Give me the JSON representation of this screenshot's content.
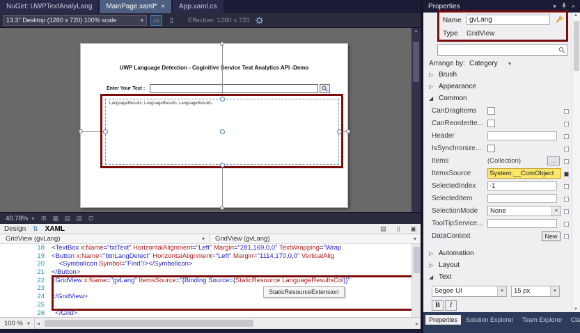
{
  "icons": {
    "dropdown": "▾",
    "close": "×",
    "monitor": "▭",
    "monitor2": "▯",
    "swap": "⇅",
    "grid1": "⊞",
    "grid2": "▦",
    "grid3": "▤",
    "grid4": "▥",
    "grid5": "⊡",
    "split1": "▤",
    "split2": "▯",
    "split3": "▣",
    "collapsed": "▷",
    "expanded": "◢",
    "scroll_up": "▲",
    "scroll_down": "▼",
    "scroll_left": "◂",
    "scroll_right": "▸"
  },
  "colors": {
    "annotation_red": "#7B0C0C",
    "active_tab_blue": "#4D6082",
    "highlight_yellow": "#FBE76B",
    "chrome_dark": "#1B1B35"
  },
  "window": {
    "doc_tabs": [
      {
        "label": "NuGet: UWPTextAnalyLang",
        "active": false,
        "closable": false
      },
      {
        "label": "MainPage.xaml*",
        "active": true,
        "closable": true
      },
      {
        "label": "App.xaml.cs",
        "active": false,
        "closable": false
      }
    ]
  },
  "designer": {
    "device_selector": "13.3\" Desktop (1280 x 720) 100% scale",
    "effective_label": "Effective: 1280 x 720",
    "zoom_value": "40.78%",
    "view_tabs": {
      "design": "Design",
      "xaml": "XAML"
    },
    "artboard": {
      "title": "UWP Language Detection - Coginitive Service Text Analytics API -Demo",
      "input_label": "Enter Your Text :",
      "gridview_text": "LanguageResults: LanguageResults: LanguageResults."
    }
  },
  "breadcrumb": {
    "left": "GridView (gvLang)",
    "right": "GridView (gvLang)"
  },
  "editor": {
    "tooltip": "StaticResourceExtension",
    "lines": [
      {
        "num": "18",
        "tokens": [
          [
            "<TextBox ",
            "t"
          ],
          [
            "x:Name",
            "a"
          ],
          [
            "=",
            "t"
          ],
          [
            "\"txtText\"",
            "s"
          ],
          [
            " ",
            "p"
          ],
          [
            "HorizontalAlignment",
            "a"
          ],
          [
            "=",
            "t"
          ],
          [
            "\"Left\"",
            "s"
          ],
          [
            " ",
            "p"
          ],
          [
            "Margin",
            "a"
          ],
          [
            "=",
            "t"
          ],
          [
            "\"281,169,0,0\"",
            "s"
          ],
          [
            " ",
            "p"
          ],
          [
            "TextWrapping",
            "a"
          ],
          [
            "=",
            "t"
          ],
          [
            "\"Wrap",
            "s"
          ]
        ]
      },
      {
        "num": "19",
        "tokens": [
          [
            "<Button ",
            "t"
          ],
          [
            "x:Name",
            "a"
          ],
          [
            "=",
            "t"
          ],
          [
            "\"btnLangDetect\"",
            "s"
          ],
          [
            " ",
            "p"
          ],
          [
            "HorizontalAlignment",
            "a"
          ],
          [
            "=",
            "t"
          ],
          [
            "\"Left\"",
            "s"
          ],
          [
            " ",
            "p"
          ],
          [
            "Margin",
            "a"
          ],
          [
            "=",
            "t"
          ],
          [
            "\"1114,170,0,0\"",
            "s"
          ],
          [
            " ",
            "p"
          ],
          [
            "VerticalAlig",
            "a"
          ]
        ]
      },
      {
        "num": "20",
        "tokens": [
          [
            "    ",
            "p"
          ],
          [
            "<SymbolIcon ",
            "t"
          ],
          [
            "Symbol",
            "a"
          ],
          [
            "=",
            "t"
          ],
          [
            "\"Find\"",
            "s"
          ],
          [
            "/></SymbolIcon>",
            "t"
          ]
        ]
      },
      {
        "num": "21",
        "tokens": [
          [
            "</Button>",
            "t"
          ]
        ]
      },
      {
        "num": "22",
        "tokens": [
          [
            "<GridView ",
            "t"
          ],
          [
            "x:Name",
            "a"
          ],
          [
            "=",
            "t"
          ],
          [
            "\"gvLang\"",
            "s"
          ],
          [
            " ",
            "p"
          ],
          [
            "ItemsSource",
            "a"
          ],
          [
            "=",
            "t"
          ],
          [
            "\"{Binding Source={",
            "s"
          ],
          [
            "StaticResource LanguageResultsCol",
            "e"
          ],
          [
            "}}\"",
            "s"
          ]
        ]
      },
      {
        "num": "23",
        "tokens": []
      },
      {
        "num": "24",
        "tokens": [
          [
            "</GridView>",
            "t"
          ]
        ]
      },
      {
        "num": "25",
        "tokens": []
      },
      {
        "num": "26",
        "tokens": [
          [
            "  ",
            "p"
          ],
          [
            "</Grid>",
            "t"
          ]
        ]
      }
    ]
  },
  "status": {
    "editor_zoom": "100 %"
  },
  "properties": {
    "panel_title": "Properties",
    "name_label": "Name",
    "name_value": "gvLang",
    "type_label": "Type",
    "type_value": "GridView",
    "arrange_label": "Arrange by:",
    "arrange_value": "Category",
    "sections_top": [
      {
        "label": "Brush",
        "expanded": false
      },
      {
        "label": "Appearance",
        "expanded": false
      },
      {
        "label": "Common",
        "expanded": true
      }
    ],
    "common_rows": [
      {
        "label": "CanDragItems",
        "control": "checkbox"
      },
      {
        "label": "CanReorderIte...",
        "control": "checkbox"
      },
      {
        "label": "Header",
        "control": "input",
        "value": ""
      },
      {
        "label": "IsSynchronize...",
        "control": "checkbox"
      },
      {
        "label": "Items",
        "control": "collection",
        "value": "(Collection)",
        "button": "..."
      },
      {
        "label": "ItemsSource",
        "control": "highlight",
        "value": "System.__ComObject",
        "marker": "filled"
      },
      {
        "label": "SelectedIndex",
        "control": "input",
        "value": "-1"
      },
      {
        "label": "SelectedItem",
        "control": "input",
        "value": ""
      },
      {
        "label": "SelectionMode",
        "control": "combo",
        "value": "None"
      },
      {
        "label": "ToolTipService...",
        "control": "input",
        "value": ""
      },
      {
        "label": "DataContext",
        "control": "button",
        "button": "New"
      }
    ],
    "sections_bottom": [
      {
        "label": "Automation",
        "expanded": false
      },
      {
        "label": "Layout",
        "expanded": false
      },
      {
        "label": "Text",
        "expanded": true
      }
    ],
    "text_editor": {
      "font_family": "Segoe UI",
      "font_size": "15 px",
      "bold": "B",
      "italic": "I"
    },
    "tool_tabs": [
      {
        "label": "Properties",
        "active": true
      },
      {
        "label": "Solution Explorer",
        "active": false
      },
      {
        "label": "Team Explorer",
        "active": false
      },
      {
        "label": "Class View",
        "active": false
      }
    ]
  }
}
